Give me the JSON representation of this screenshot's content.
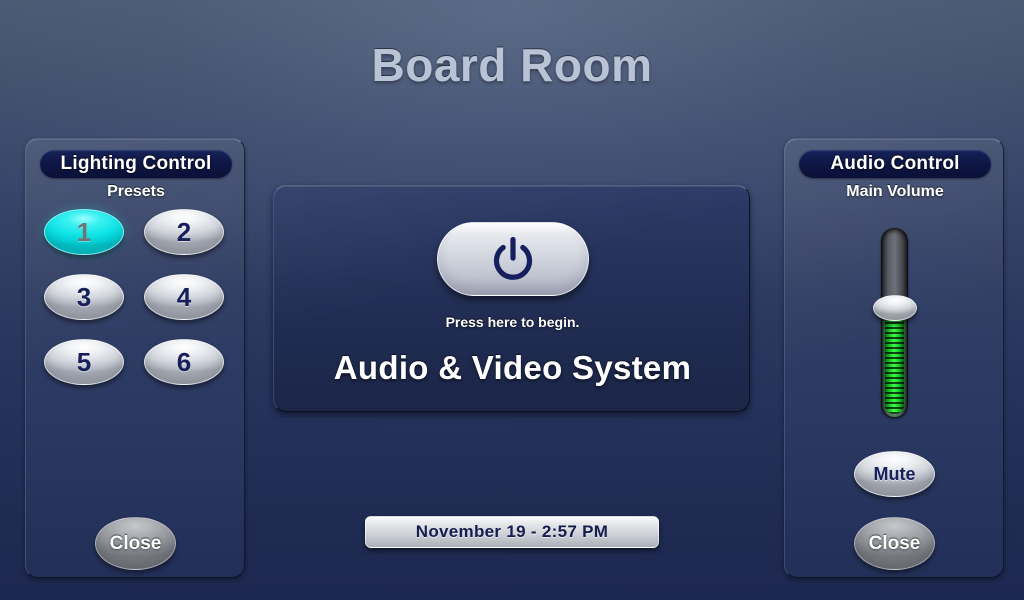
{
  "room": {
    "title": "Board Room"
  },
  "lighting": {
    "header": "Lighting Control",
    "subheader": "Presets",
    "presets": [
      {
        "label": "1",
        "active": true
      },
      {
        "label": "2",
        "active": false
      },
      {
        "label": "3",
        "active": false
      },
      {
        "label": "4",
        "active": false
      },
      {
        "label": "5",
        "active": false
      },
      {
        "label": "6",
        "active": false
      }
    ],
    "close_label": "Close",
    "active_color": "#10e4e6"
  },
  "center": {
    "power_icon": "power-icon",
    "press_text": "Press here to begin.",
    "system_title": "Audio & Video System",
    "power_icon_color": "#16205e"
  },
  "audio": {
    "header": "Audio Control",
    "subheader": "Main Volume",
    "volume_percent": 58,
    "fill_color": "#3cff4a",
    "mute_label": "Mute",
    "close_label": "Close"
  },
  "clock": {
    "text": "November 19  -  2:57 PM"
  }
}
